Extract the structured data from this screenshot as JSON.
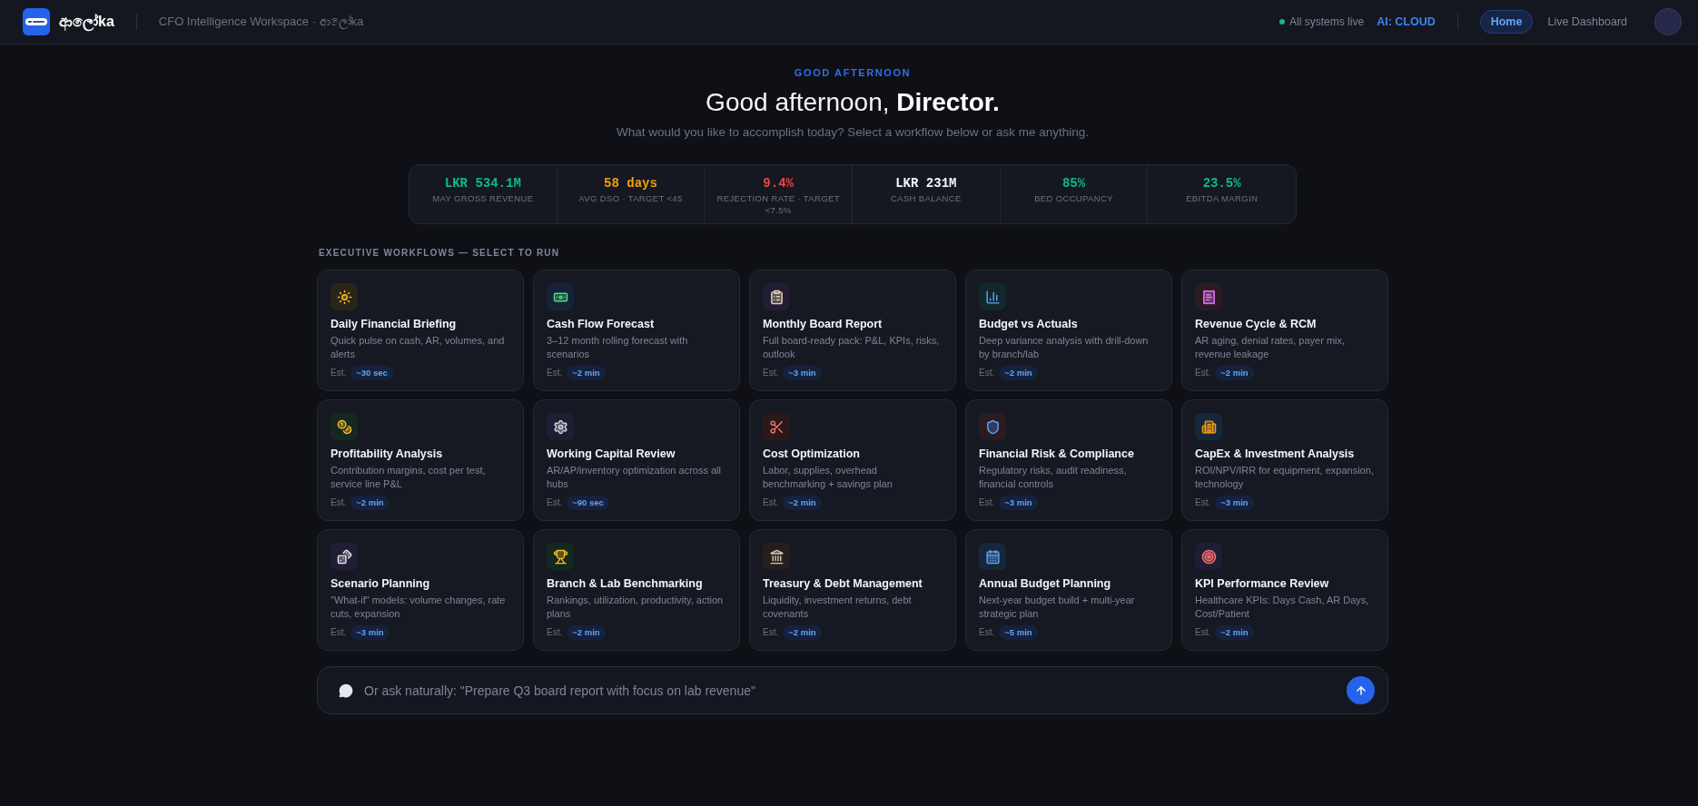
{
  "header": {
    "brand": "ආලෝka",
    "tagline": "CFO Intelligence Workspace · ආලෝka",
    "status": "All systems live",
    "ai_mode": "AI: CLOUD",
    "nav": [
      {
        "label": "Home",
        "selected": true
      },
      {
        "label": "Live Dashboard",
        "selected": false
      }
    ]
  },
  "hero": {
    "eyebrow": "GOOD AFTERNOON",
    "title": "Good afternoon, **Director.**",
    "subtitle": "What would you like to accomplish today? Select a workflow below or ask me anything."
  },
  "kpis": [
    {
      "value": "LKR 534.1M",
      "label": "MAY GROSS REVENUE",
      "color": "#10b981"
    },
    {
      "value": "58 days",
      "label": "AVG DSO · TARGET <45",
      "color": "#f59e0b"
    },
    {
      "value": "9.4%",
      "label": "REJECTION RATE · TARGET <7.5%",
      "color": "#ef4444"
    },
    {
      "value": "LKR 231M",
      "label": "CASH BALANCE",
      "color": "#f3f4f6"
    },
    {
      "value": "85%",
      "label": "BED OCCUPANCY",
      "color": "#10b981"
    },
    {
      "value": "23.5%",
      "label": "EBITDA MARGIN",
      "color": "#10b981"
    }
  ],
  "workflows": {
    "heading": "EXECUTIVE WORKFLOWS — SELECT TO RUN",
    "cards": [
      {
        "title": "Daily Financial Briefing",
        "description": "Quick pulse on cash, AR, volumes, and alerts",
        "est_label": "Est.",
        "duration": "~30 sec"
      },
      {
        "title": "Cash Flow Forecast",
        "description": "3–12 month rolling forecast with scenarios",
        "est_label": "Est.",
        "duration": "~2 min"
      },
      {
        "title": "Monthly Board Report",
        "description": "Full board-ready pack: P&L, KPIs, risks, outlook",
        "est_label": "Est.",
        "duration": "~3 min"
      },
      {
        "title": "Budget vs Actuals",
        "description": "Deep variance analysis with drill-down by branch/lab",
        "est_label": "Est.",
        "duration": "~2 min"
      },
      {
        "title": "Revenue Cycle & RCM",
        "description": "AR aging, denial rates, payer mix, revenue leakage",
        "est_label": "Est.",
        "duration": "~2 min"
      },
      {
        "title": "Profitability Analysis",
        "description": "Contribution margins, cost per test, service line P&L",
        "est_label": "Est.",
        "duration": "~2 min"
      },
      {
        "title": "Working Capital Review",
        "description": "AR/AP/inventory optimization across all hubs",
        "est_label": "Est.",
        "duration": "~90 sec"
      },
      {
        "title": "Cost Optimization",
        "description": "Labor, supplies, overhead benchmarking + savings plan",
        "est_label": "Est.",
        "duration": "~2 min"
      },
      {
        "title": "Financial Risk & Compliance",
        "description": "Regulatory risks, audit readiness, financial controls",
        "est_label": "Est.",
        "duration": "~3 min"
      },
      {
        "title": "CapEx & Investment Analysis",
        "description": "ROI/NPV/IRR for equipment, expansion, technology",
        "est_label": "Est.",
        "duration": "~3 min"
      },
      {
        "title": "Scenario Planning",
        "description": "\"What-if\" models: volume changes, rate cuts, expansion",
        "est_label": "Est.",
        "duration": "~3 min"
      },
      {
        "title": "Branch & Lab Benchmarking",
        "description": "Rankings, utilization, productivity, action plans",
        "est_label": "Est.",
        "duration": "~2 min"
      },
      {
        "title": "Treasury & Debt Management",
        "description": "Liquidity, investment returns, debt covenants",
        "est_label": "Est.",
        "duration": "~2 min"
      },
      {
        "title": "Annual Budget Planning",
        "description": "Next-year budget build + multi-year strategic plan",
        "est_label": "Est.",
        "duration": "~5 min"
      },
      {
        "title": "KPI Performance Review",
        "description": "Healthcare KPIs: Days Cash, AR Days, Cost/Patient",
        "est_label": "Est.",
        "duration": "~2 min"
      }
    ]
  },
  "ask": {
    "placeholder": "Or ask naturally: \"Prepare Q3 board report with focus on lab revenue\""
  }
}
